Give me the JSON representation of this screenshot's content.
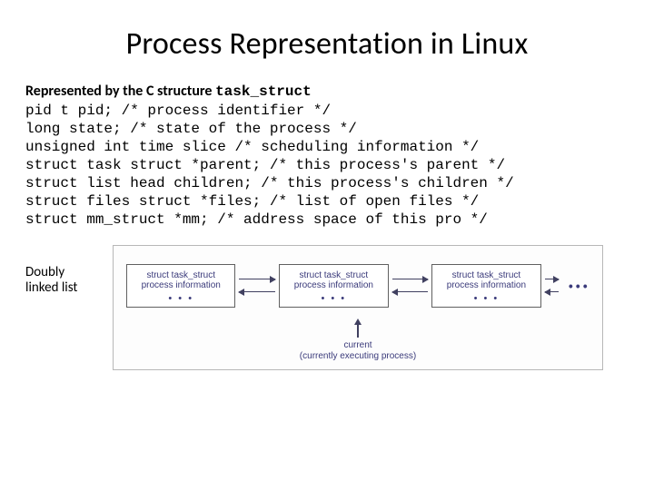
{
  "title": "Process Representation in Linux",
  "intro_prefix": "Represented by the C structure ",
  "intro_struct": "task_struct",
  "code": "pid t pid; /* process identifier */\nlong state; /* state of the process */\nunsigned int time slice /* scheduling information */\nstruct task struct *parent; /* this process's parent */\nstruct list head children; /* this process's children */\nstruct files struct *files; /* list of open files */\nstruct mm_struct *mm; /* address space of this pro */",
  "side_label_l1": "Doubly",
  "side_label_l2": "linked list",
  "node": {
    "line1": "struct task_struct",
    "line2": "process information",
    "vdots": "•\n•\n•"
  },
  "ellipsis": "• • •",
  "current_label": "current",
  "current_sub": "(currently executing process)"
}
